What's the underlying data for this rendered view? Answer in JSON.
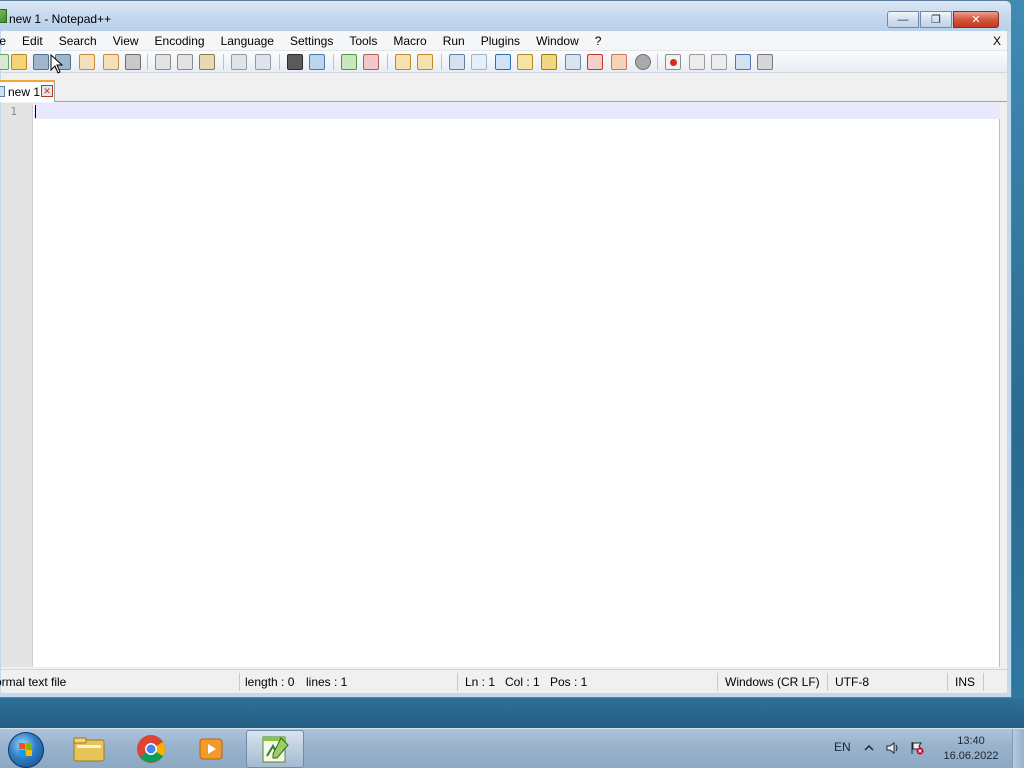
{
  "window": {
    "title": "new 1 - Notepad++",
    "controls": {
      "minimize": "—",
      "maximize": "❐",
      "close": "✕"
    }
  },
  "menu": {
    "items": [
      "ile",
      "Edit",
      "Search",
      "View",
      "Encoding",
      "Language",
      "Settings",
      "Tools",
      "Macro",
      "Run",
      "Plugins",
      "Window",
      "?"
    ],
    "close_label": "X"
  },
  "tab": {
    "label": "new 1",
    "close_glyph": "✕"
  },
  "editor": {
    "line_number": "1",
    "content": ""
  },
  "status": {
    "file_type": "ormal text file",
    "length": "length : 0",
    "lines": "lines : 1",
    "ln": "Ln : 1",
    "col": "Col : 1",
    "pos": "Pos : 1",
    "eol": "Windows (CR LF)",
    "encoding": "UTF-8",
    "mode": "INS"
  },
  "taskbar": {
    "apps": [
      "start-orb",
      "file-explorer-icon",
      "chrome-icon",
      "media-player-icon",
      "notepadpp-icon"
    ],
    "language": "EN",
    "time": "13:40",
    "date": "16.06.2022"
  },
  "colors": {
    "tab_accent": "#f3a537",
    "current_line": "#e8e8ff",
    "gutter": "#e4e4e4"
  }
}
